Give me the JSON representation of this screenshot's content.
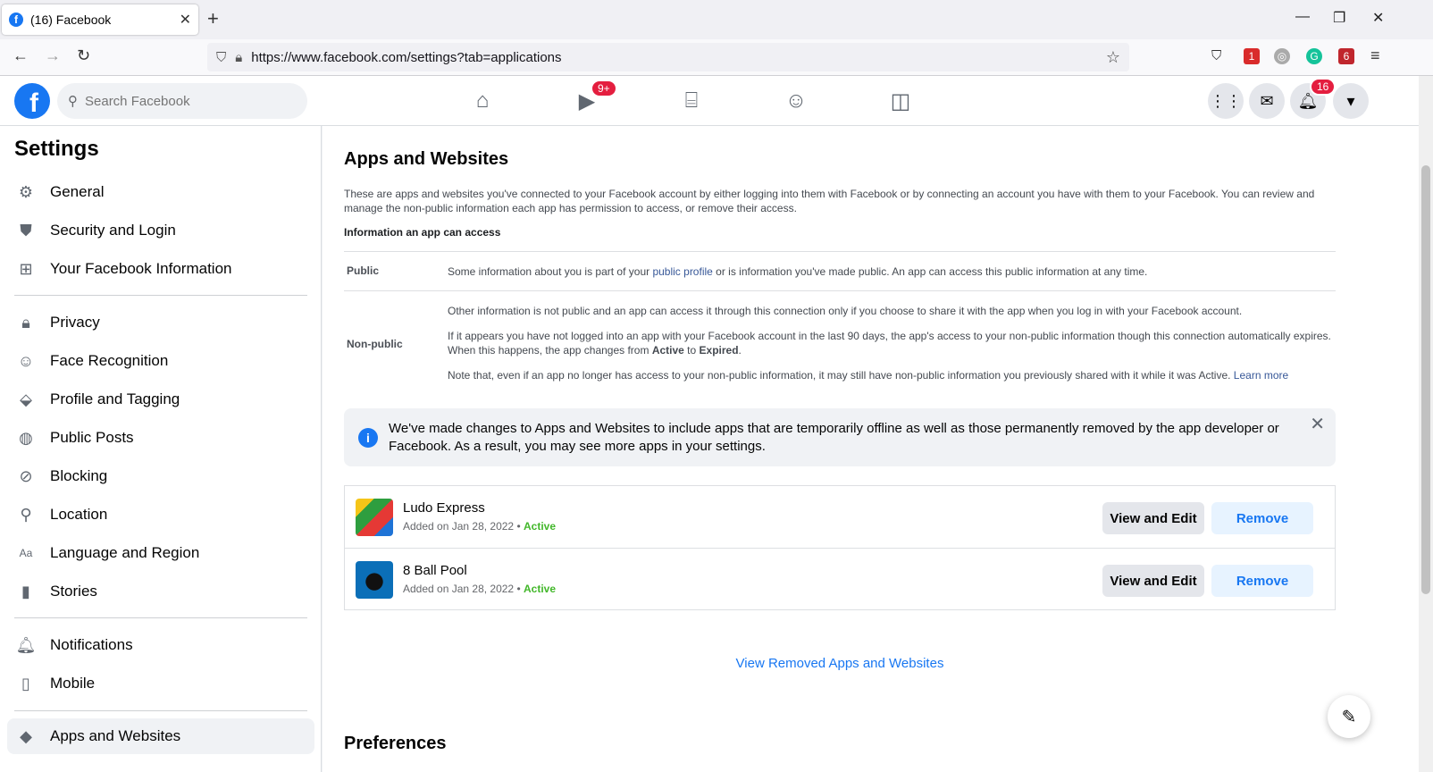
{
  "browser": {
    "tab_title": "(16) Facebook",
    "url": "https://www.facebook.com/settings?tab=applications",
    "ext_badge_1": "1",
    "ext_badge_2": "6"
  },
  "fb_header": {
    "search_placeholder": "Search Facebook",
    "watch_badge": "9+",
    "notifications_badge": "16"
  },
  "sidebar": {
    "title": "Settings",
    "groups": [
      [
        {
          "label": "General",
          "icon": "gear-icon"
        },
        {
          "label": "Security and Login",
          "icon": "shield-icon"
        },
        {
          "label": "Your Facebook Information",
          "icon": "grid-icon"
        }
      ],
      [
        {
          "label": "Privacy",
          "icon": "lock-icon"
        },
        {
          "label": "Face Recognition",
          "icon": "face-icon"
        },
        {
          "label": "Profile and Tagging",
          "icon": "tag-icon"
        },
        {
          "label": "Public Posts",
          "icon": "globe-icon"
        },
        {
          "label": "Blocking",
          "icon": "block-user-icon"
        },
        {
          "label": "Location",
          "icon": "location-pin-icon"
        },
        {
          "label": "Language and Region",
          "icon": "language-icon"
        },
        {
          "label": "Stories",
          "icon": "book-icon"
        }
      ],
      [
        {
          "label": "Notifications",
          "icon": "bell-icon"
        },
        {
          "label": "Mobile",
          "icon": "phone-icon"
        }
      ],
      [
        {
          "label": "Apps and Websites",
          "icon": "cube-icon"
        }
      ]
    ]
  },
  "main": {
    "title": "Apps and Websites",
    "description": "These are apps and websites you've connected to your Facebook account by either logging into them with Facebook or by connecting an account you have with them to your Facebook. You can review and manage the non-public information each app has permission to access, or remove their access.",
    "info_heading": "Information an app can access",
    "public_label": "Public",
    "public_text_before": "Some information about you is part of your ",
    "public_link": "public profile",
    "public_text_after": " or is information you've made public. An app can access this public information at any time.",
    "nonpublic_label": "Non-public",
    "nonpublic_p1": "Other information is not public and an app can access it through this connection only if you choose to share it with the app when you log in with your Facebook account.",
    "nonpublic_p2_before": "If it appears you have not logged into an app with your Facebook account in the last 90 days, the app's access to your non-public information though this connection automatically expires. When this happens, the app changes from ",
    "nonpublic_p2_active": "Active",
    "nonpublic_p2_to": " to ",
    "nonpublic_p2_expired": "Expired",
    "nonpublic_p2_end": ".",
    "nonpublic_p3": "Note that, even if an app no longer has access to your non-public information, it may still have non-public information you previously shared with it while it was Active. ",
    "learn_more": "Learn more",
    "notice": "We've made changes to Apps and Websites to include apps that are temporarily offline as well as those permanently removed by the app developer or Facebook. As a result, you may see more apps in your settings.",
    "apps": [
      {
        "name": "Ludo Express",
        "added": "Added on Jan 28, 2022",
        "sep": " • ",
        "status": "Active",
        "edit_label": "View and Edit",
        "remove_label": "Remove"
      },
      {
        "name": "8 Ball Pool",
        "added": "Added on Jan 28, 2022",
        "sep": " • ",
        "status": "Active",
        "edit_label": "View and Edit",
        "remove_label": "Remove"
      }
    ],
    "view_removed": "View Removed Apps and Websites",
    "preferences": "Preferences"
  },
  "colors": {
    "brand": "#1877f2",
    "badge": "#e41e3f",
    "active_green": "#42b72a"
  }
}
